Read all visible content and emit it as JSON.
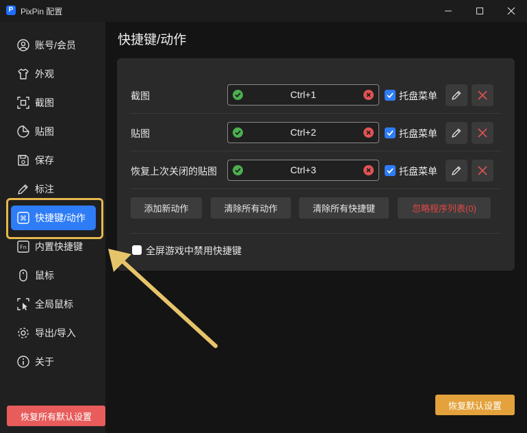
{
  "window": {
    "title": "PixPin 配置",
    "app_icon_letter": "P"
  },
  "sidebar": {
    "items": [
      {
        "label": "账号/会员",
        "icon": "user-icon"
      },
      {
        "label": "外观",
        "icon": "shirt-icon"
      },
      {
        "label": "截图",
        "icon": "screenshot-icon"
      },
      {
        "label": "贴图",
        "icon": "sticker-icon"
      },
      {
        "label": "保存",
        "icon": "save-icon"
      },
      {
        "label": "标注",
        "icon": "pencil-icon"
      },
      {
        "label": "快捷键/动作",
        "icon": "command-icon",
        "active": true
      },
      {
        "label": "内置快捷键",
        "icon": "fn-key-icon"
      },
      {
        "label": "鼠标",
        "icon": "mouse-icon"
      },
      {
        "label": "全局鼠标",
        "icon": "cursor-icon"
      },
      {
        "label": "导出/导入",
        "icon": "gear-icon"
      },
      {
        "label": "关于",
        "icon": "info-icon"
      }
    ],
    "reset_all_label": "恢复所有默认设置"
  },
  "main": {
    "title": "快捷键/动作",
    "shortcuts": [
      {
        "label": "截图",
        "key": "Ctrl+1",
        "tray_label": "托盘菜单",
        "tray_checked": true
      },
      {
        "label": "贴图",
        "key": "Ctrl+2",
        "tray_label": "托盘菜单",
        "tray_checked": true
      },
      {
        "label": "恢复上次关闭的贴图",
        "key": "Ctrl+3",
        "tray_label": "托盘菜单",
        "tray_checked": true
      }
    ],
    "buttons": {
      "add_action": "添加新动作",
      "clear_actions": "清除所有动作",
      "clear_shortcuts": "清除所有快捷键",
      "ignore_list": "忽略程序列表(0)"
    },
    "fullscreen_game_label": "全屏游戏中禁用快捷键",
    "fullscreen_game_checked": false,
    "reset_default_label": "恢复默认设置"
  },
  "colors": {
    "accent": "#2e7cf6",
    "highlight": "#e6b84c",
    "danger": "#e85c5c",
    "warning": "#e3a23b"
  }
}
